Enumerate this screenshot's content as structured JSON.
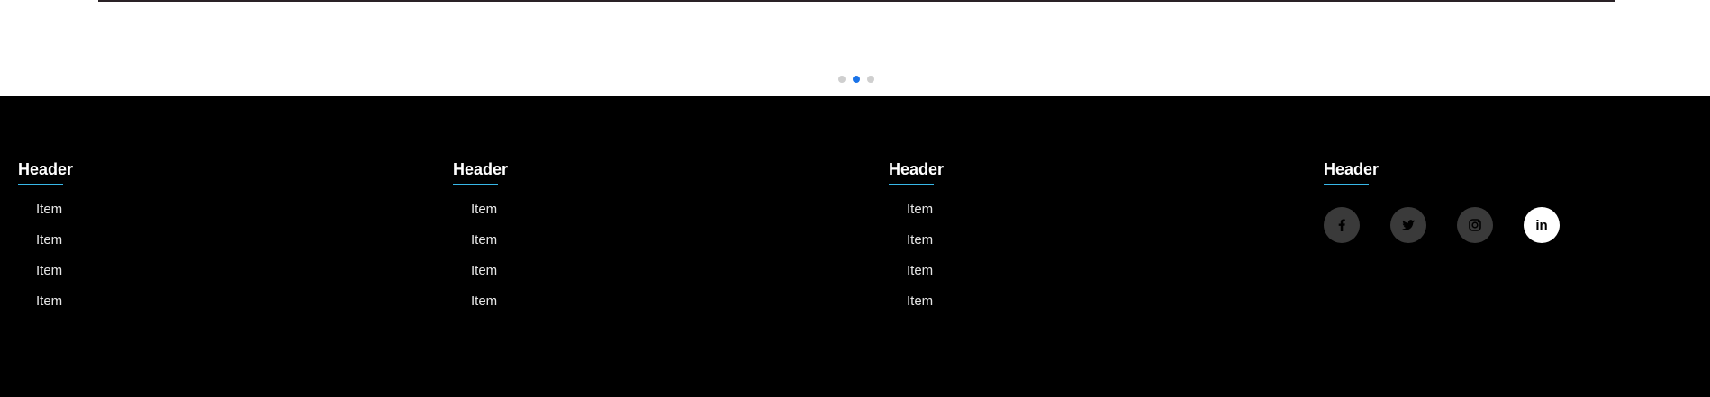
{
  "carousel": {
    "dots": 3,
    "active_index": 1,
    "dot_color": "#cfcfcf",
    "active_color": "#1a73e8"
  },
  "footer": {
    "background": "#000000",
    "underline_color": "#38b8e8",
    "columns": [
      {
        "header": "Header",
        "items": [
          "Item",
          "Item",
          "Item",
          "Item"
        ]
      },
      {
        "header": "Header",
        "items": [
          "Item",
          "Item",
          "Item",
          "Item"
        ]
      },
      {
        "header": "Header",
        "items": [
          "Item",
          "Item",
          "Item",
          "Item"
        ]
      }
    ],
    "social_column": {
      "header": "Header",
      "icons": [
        {
          "name": "facebook-icon",
          "active": false
        },
        {
          "name": "twitter-icon",
          "active": false
        },
        {
          "name": "instagram-icon",
          "active": false
        },
        {
          "name": "linkedin-icon",
          "active": true,
          "glyph": "in"
        }
      ]
    }
  }
}
